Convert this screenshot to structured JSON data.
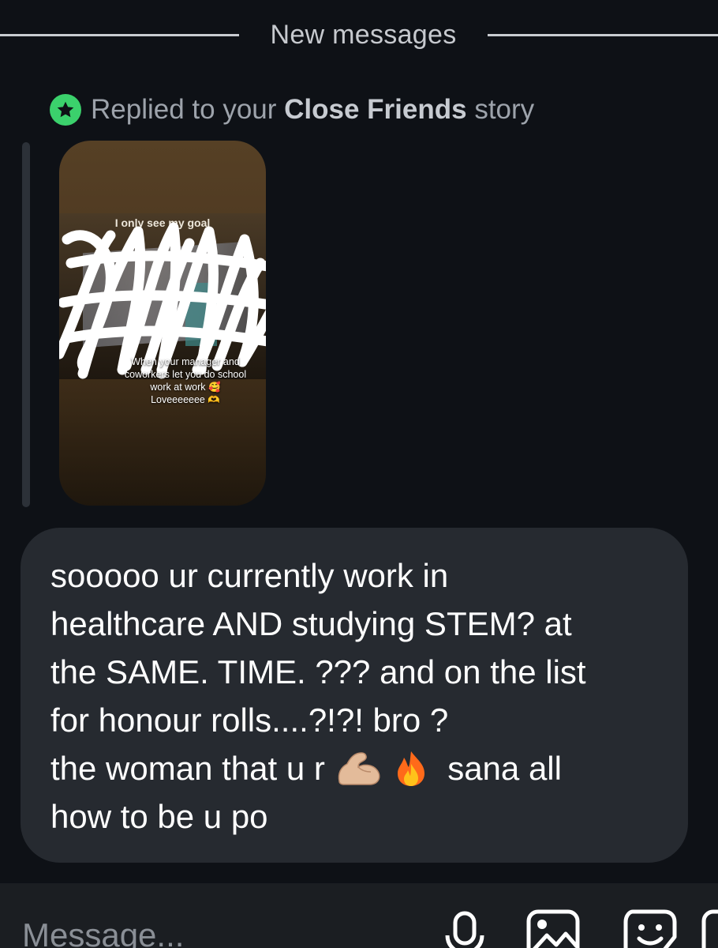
{
  "divider": {
    "label": "New messages"
  },
  "reply_header": {
    "prefix": "Replied to your ",
    "highlight": "Close Friends",
    "suffix": " story"
  },
  "story": {
    "top_caption": "I only see my goal",
    "caption_lines": [
      "When your manager and",
      "coworkers let you do school",
      "work at work 🥰",
      "Loveeeeeee 🫶"
    ]
  },
  "message": {
    "lines": [
      "sooooo ur currently work in",
      "healthcare AND studying STEM? at",
      "the SAME. TIME. ??? and on the list",
      "for honour rolls....?!?! bro ?"
    ],
    "line5_prefix": "the woman that u r ",
    "line5_suffix": " sana all",
    "line6": "how to be u po"
  },
  "composer": {
    "placeholder": "Message..."
  },
  "icons": {
    "star": "star-icon",
    "mic": "microphone-icon",
    "gallery": "gallery-icon",
    "sticker": "sticker-icon",
    "muscle": "flexed-biceps-emoji",
    "fire": "fire-emoji"
  },
  "colors": {
    "background": "#0e1116",
    "bubble": "#262a30",
    "close_friends_green": "#3bd16c"
  }
}
